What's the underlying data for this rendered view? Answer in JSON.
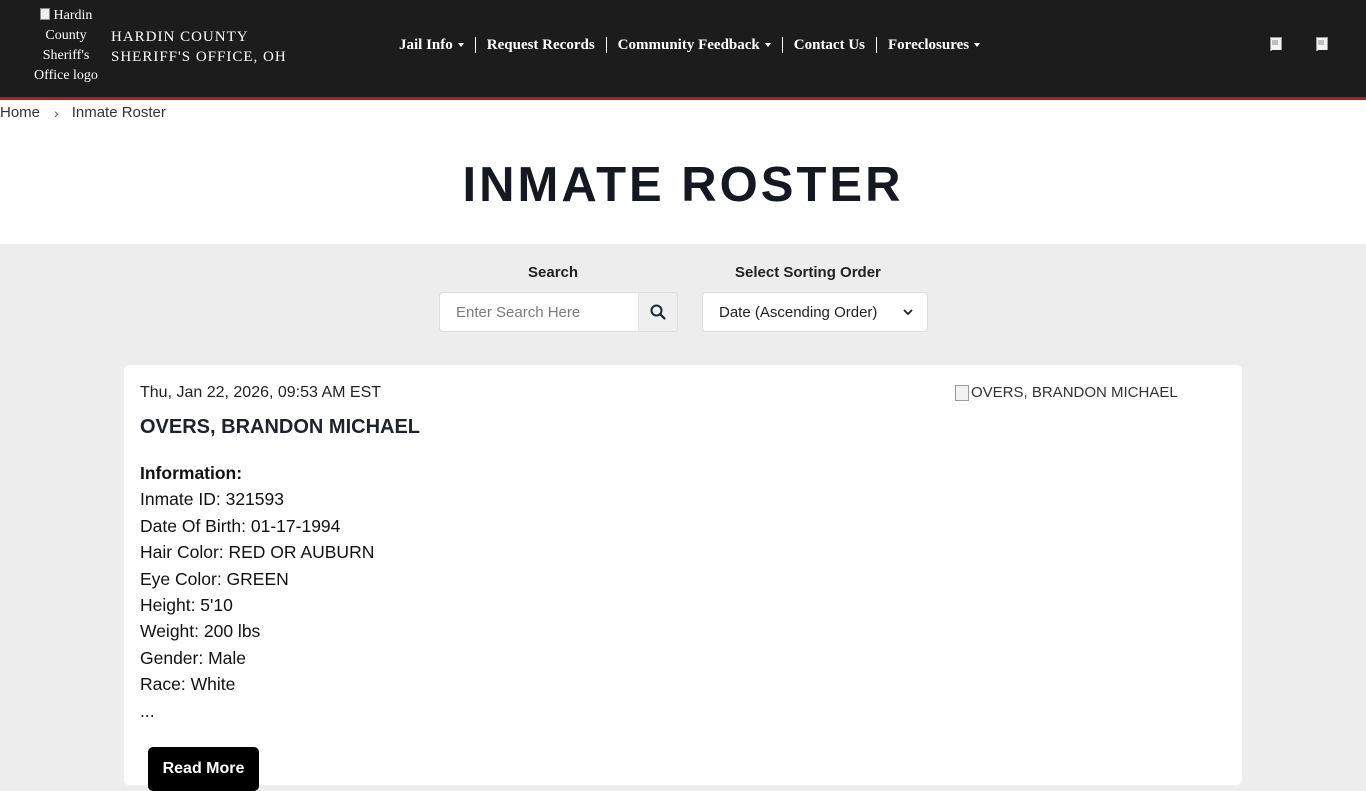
{
  "header": {
    "logo_alt": "Hardin County Sheriff's Office logo",
    "brand_line1": "HARDIN COUNTY",
    "brand_line2": "SHERIFF'S OFFICE, OH",
    "nav": [
      {
        "label": "Jail Info",
        "dropdown": true
      },
      {
        "label": "Request Records",
        "dropdown": false
      },
      {
        "label": "Community Feedback",
        "dropdown": true
      },
      {
        "label": "Contact Us",
        "dropdown": false
      },
      {
        "label": "Foreclosures",
        "dropdown": true
      }
    ],
    "accent_color": "#c4161c",
    "background_color": "#1c1c1c"
  },
  "breadcrumb": {
    "home": "Home",
    "separator": "›",
    "current": "Inmate Roster"
  },
  "page": {
    "title": "INMATE ROSTER"
  },
  "filters": {
    "search_label": "Search",
    "search_placeholder": "Enter Search Here",
    "search_value": "",
    "search_icon": "search-icon",
    "sort_label": "Select Sorting Order",
    "sort_selected": "Date (Ascending Order)"
  },
  "inmate": {
    "date": "Thu, Jan 22, 2026, 09:53 AM EST",
    "name": "OVERS, BRANDON MICHAEL",
    "photo_alt": "OVERS, BRANDON MICHAEL",
    "info_heading": "Information:",
    "info": [
      "Inmate ID: 321593",
      "Date Of Birth: 01-17-1994",
      "Hair Color: RED OR AUBURN",
      "Eye Color: GREEN",
      "Height: 5'10",
      "Weight: 200 lbs",
      "Gender: Male",
      "Race: White",
      "..."
    ],
    "read_more": "Read More"
  }
}
